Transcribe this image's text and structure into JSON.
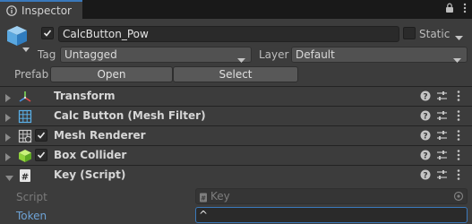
{
  "tab": {
    "title": "Inspector",
    "icon": "info-icon"
  },
  "header": {
    "name": "CalcButton_Pow",
    "static_label": "Static",
    "tag_label": "Tag",
    "tag_value": "Untagged",
    "layer_label": "Layer",
    "layer_value": "Default",
    "prefab_label": "Prefab",
    "open_label": "Open",
    "select_label": "Select"
  },
  "components": [
    {
      "name": "Transform",
      "icon": "transform-icon"
    },
    {
      "name": "Calc Button (Mesh Filter)",
      "icon": "mesh-filter-icon"
    },
    {
      "name": "Mesh Renderer",
      "icon": "mesh-renderer-icon"
    },
    {
      "name": "Box Collider",
      "icon": "box-collider-icon"
    },
    {
      "name": "Key (Script)",
      "icon": "script-icon"
    }
  ],
  "script_fields": {
    "script_label": "Script",
    "script_value": "Key",
    "token_label": "Token",
    "token_value": "^"
  },
  "colors": {
    "accent": "#3a79bb",
    "panel": "#3c3c3c",
    "tab_bar": "#191919",
    "token_label": "#6ea3d6"
  }
}
